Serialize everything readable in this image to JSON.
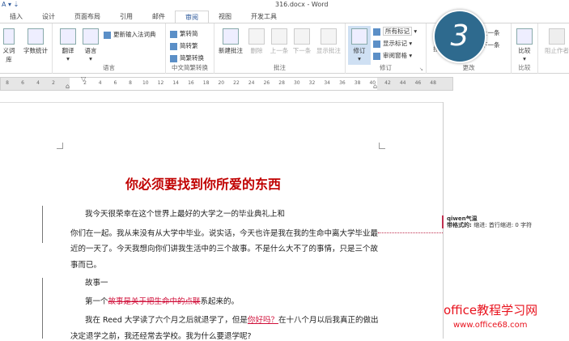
{
  "title": "316.docx - Word",
  "tabs": [
    "插入",
    "设计",
    "页面布局",
    "引用",
    "邮件",
    "审阅",
    "视图",
    "开发工具"
  ],
  "active_tab": "审阅",
  "ribbon": {
    "proof": {
      "thesaurus": "义词库",
      "wordcount": "字数统计"
    },
    "language": {
      "translate": "翻译",
      "language": "语言",
      "update_ime": "更新输入法词典",
      "label": "语言"
    },
    "chinese": {
      "t2s": "繁转简",
      "s2t": "简转繁",
      "convert": "简繁转换",
      "label": "中文简繁转换"
    },
    "comments": {
      "new": "新建批注",
      "delete": "删除",
      "prev": "上一条",
      "next": "下一条",
      "show": "显示批注",
      "label": "批注"
    },
    "tracking": {
      "track": "修订",
      "markup": "所有标记",
      "show_markup": "显示标记",
      "pane": "审阅窗格",
      "label": "修订"
    },
    "changes": {
      "accept": "接",
      "prev": "上一条",
      "next": "下一条",
      "label": "更改"
    },
    "compare": {
      "compare": "比较",
      "label": "比较"
    },
    "protect": {
      "block": "阻止作者"
    }
  },
  "step_badge": "3",
  "ruler": [
    "8",
    "6",
    "4",
    "2",
    "2",
    "4",
    "6",
    "8",
    "10",
    "12",
    "14",
    "16",
    "18",
    "20",
    "22",
    "24",
    "26",
    "28",
    "30",
    "32",
    "34",
    "36",
    "38",
    "40",
    "42",
    "44",
    "46",
    "48"
  ],
  "doc": {
    "heading": "你必须要找到你所爱的东西",
    "p1a": "我今天很荣幸在这个世界上最好的大学之一的毕业典礼上和",
    "p1b": "你们在一起。我从来没有从大学中毕业。说实话，今天也许是我在我的生命中离大学毕业最",
    "p1c": "近的一天了。今天我想向你们讲我生活中的三个故事。不是什么大不了的事情，只是三个故",
    "p1d": "事而已。",
    "p2": "故事一",
    "p3a": "第一个",
    "p3del": "故事是关于把生命中的点联",
    "p3b": "系起来的。",
    "p4a": "我在 Reed 大学读了六个月之后就退学了，但是",
    "p4ins": "你好吗？",
    "p4b": "在十八个月以后我真正的做出",
    "p4c": "决定退学之前，我还经常去学校。我为什么要退学呢?"
  },
  "markup_balloon": {
    "author": "qiwen气温",
    "label": "带格式的:",
    "detail": "缩进: 首行缩进:  0 字符"
  },
  "watermark": {
    "line1": "office教程学习网",
    "line2": "www.office68.com"
  }
}
